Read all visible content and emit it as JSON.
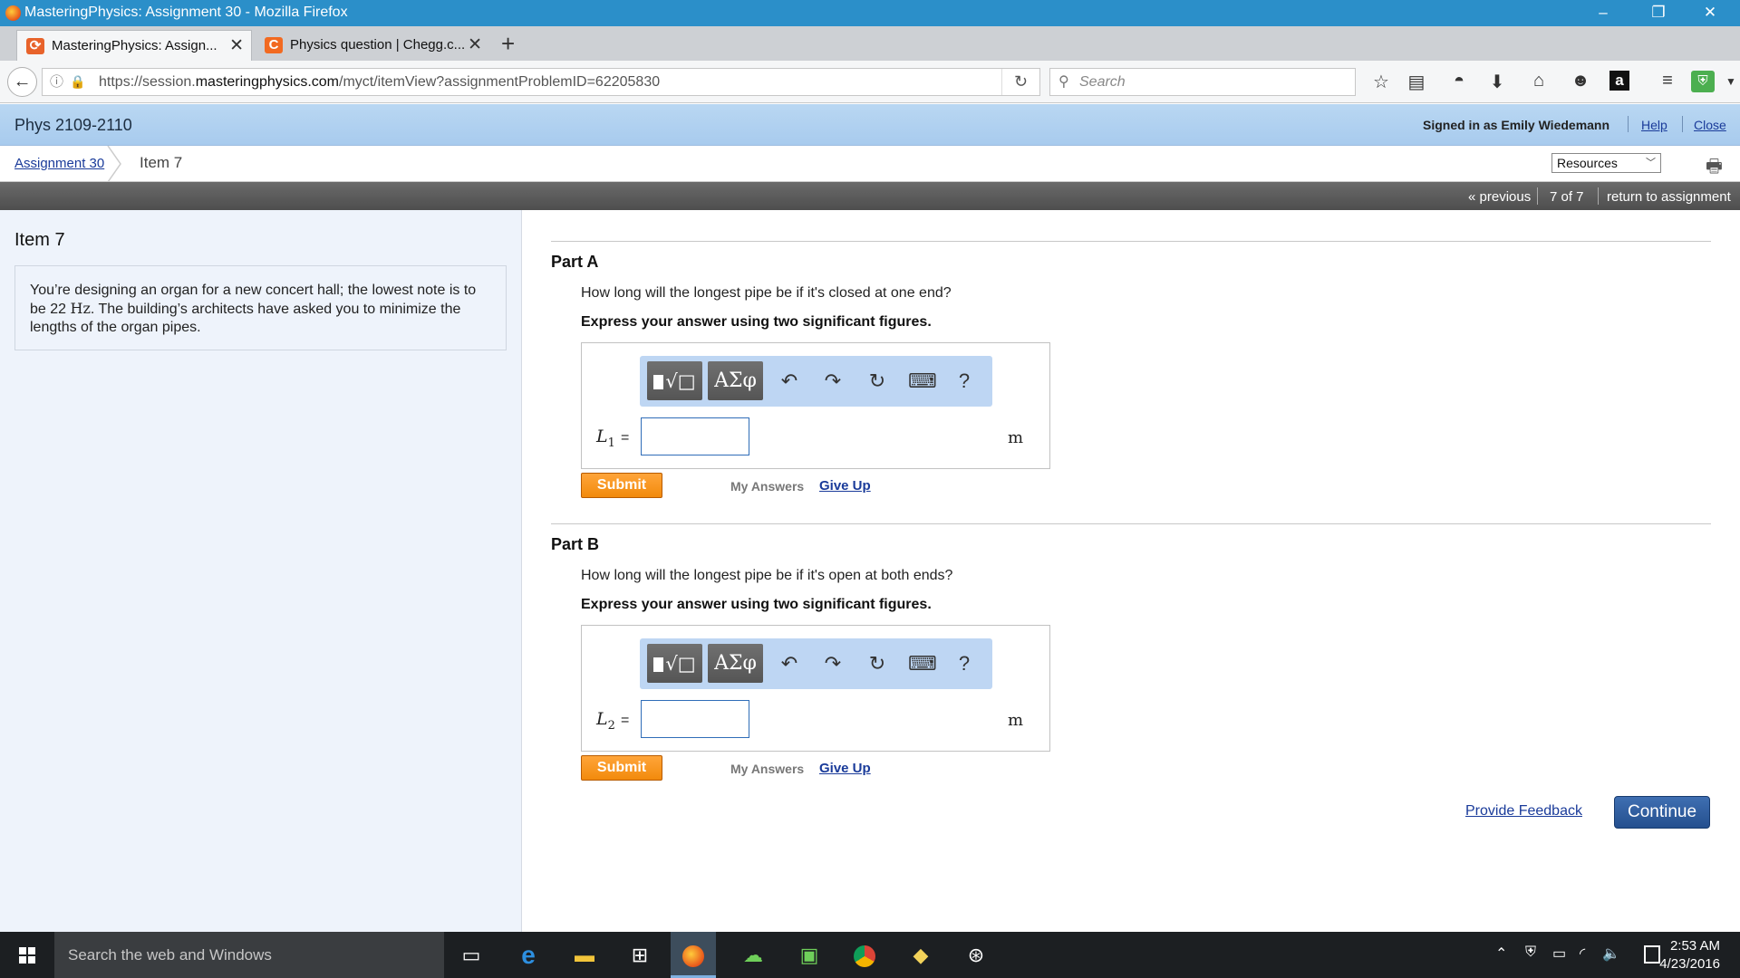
{
  "window": {
    "title": "MasteringPhysics: Assignment 30 - Mozilla Firefox",
    "controls": [
      "–",
      "❐",
      "✕"
    ]
  },
  "tabs": [
    {
      "label": "MasteringPhysics: Assign...",
      "active": true
    },
    {
      "label": "Physics question | Chegg.c...",
      "active": false
    }
  ],
  "browser": {
    "url_prefix": "https://session.",
    "url_domain": "masteringphysics.com",
    "url_path": "/myct/itemView?assignmentProblemID=62205830",
    "search_placeholder": "Search"
  },
  "header": {
    "course": "Phys 2109-2110",
    "signed_in": "Signed in as Emily Wiedemann",
    "help": "Help",
    "close": "Close"
  },
  "breadcrumb": {
    "assignment": "Assignment 30",
    "item": "Item 7",
    "resources": "Resources"
  },
  "itemnav": {
    "previous": "« previous",
    "position": "7 of 7",
    "return": "return to assignment"
  },
  "left": {
    "title": "Item 7",
    "problem_pre": "You’re designing an organ for a new concert hall; the lowest note is to be 22 ",
    "problem_unit": "Hz",
    "problem_post": ". The building’s architects have asked you to minimize the lengths of the organ pipes."
  },
  "partA": {
    "label": "Part A",
    "question": "How long will the longest pipe be if it's closed at one end?",
    "instruction": "Express your answer using two significant figures.",
    "var": "L",
    "var_sub": "1",
    "equals": "=",
    "unit": "m",
    "submit": "Submit",
    "my_answers": "My Answers",
    "give_up": "Give Up"
  },
  "partB": {
    "label": "Part B",
    "question": "How long will the longest pipe be if it's open at both ends?",
    "instruction": "Express your answer using two significant figures.",
    "var": "L",
    "var_sub": "2",
    "equals": "=",
    "unit": "m",
    "submit": "Submit",
    "my_answers": "My Answers",
    "give_up": "Give Up"
  },
  "toolbar": {
    "templates": "√",
    "greek": "ΑΣφ",
    "undo": "↶",
    "redo": "↷",
    "reset": "↻",
    "keyboard": "⌨",
    "help": "?"
  },
  "footer": {
    "feedback": "Provide Feedback",
    "continue": "Continue"
  },
  "taskbar": {
    "search": "Search the web and Windows",
    "time": "2:53 AM",
    "date": "4/23/2016"
  },
  "colors": {
    "titlebar": "#2b8fc9",
    "header": "#b9d7f2",
    "submit": "#f28a0c",
    "continue": "#2d5a9e",
    "link": "#1a3b9a"
  }
}
